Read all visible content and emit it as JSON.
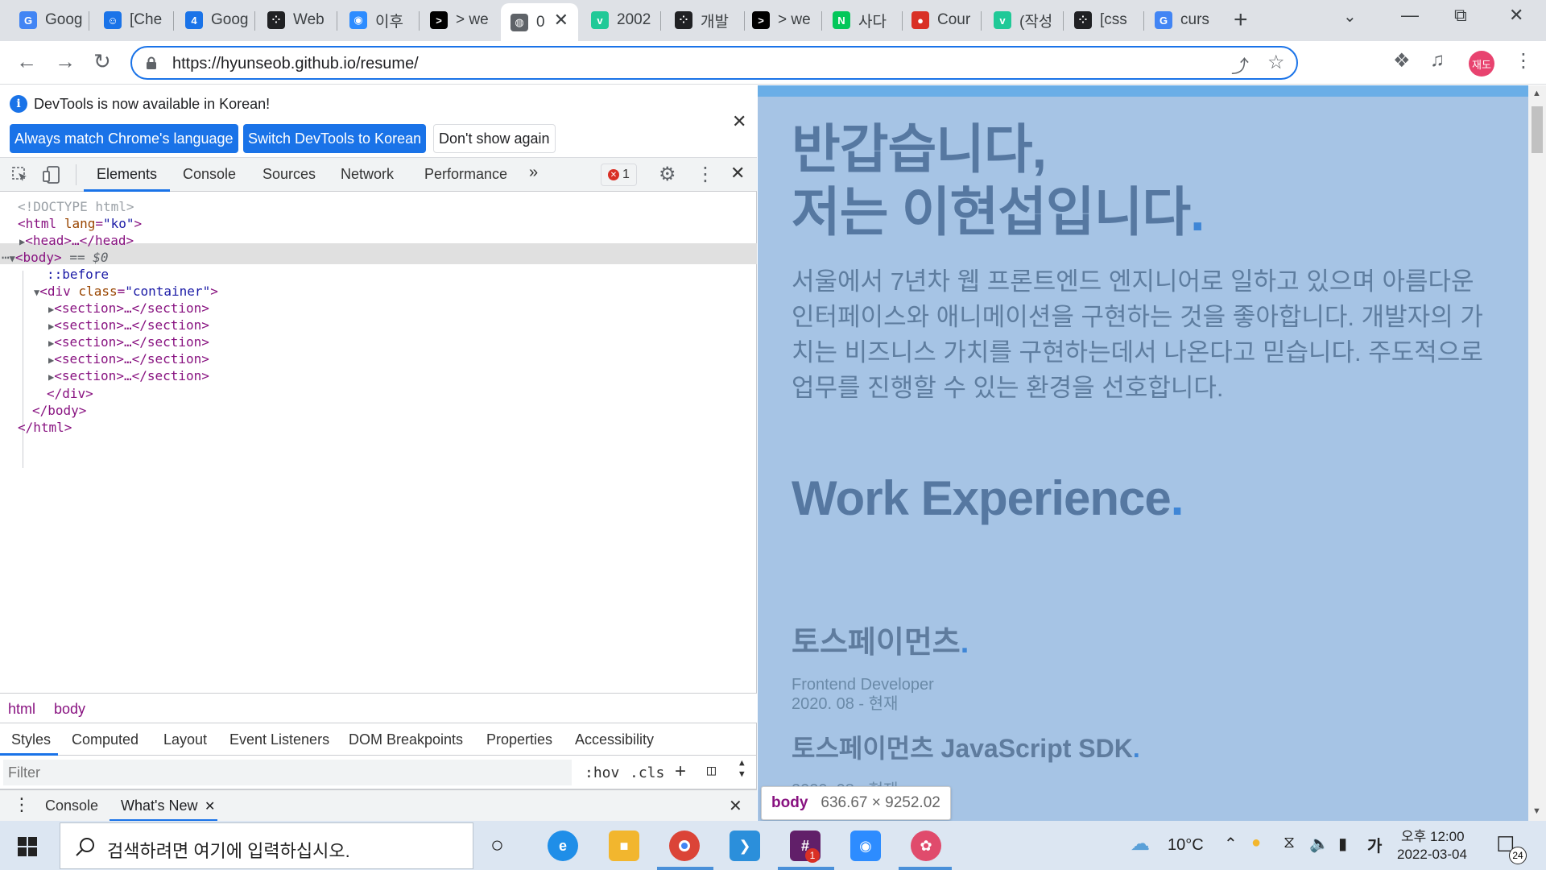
{
  "browser": {
    "tabs": [
      {
        "title": "Goog",
        "favicon": "google-icon",
        "color": "#4285f4",
        "glyph": "G"
      },
      {
        "title": "[Che",
        "favicon": "contacts-icon",
        "color": "#1a73e8",
        "glyph": "☺"
      },
      {
        "title": "Goog",
        "favicon": "google-calendar-icon",
        "color": "#1a73e8",
        "glyph": "4"
      },
      {
        "title": "Web",
        "favicon": "dots-icon",
        "color": "#202124",
        "glyph": "⁘"
      },
      {
        "title": "이후",
        "favicon": "zoom-icon",
        "color": "#2d8cff",
        "glyph": "◉"
      },
      {
        "title": "> we",
        "favicon": "terminal-icon",
        "color": "#000000",
        "glyph": ">"
      },
      {
        "title": "0",
        "favicon": "globe-icon",
        "color": "#5f6368",
        "glyph": "◍",
        "active": true
      },
      {
        "title": "2002",
        "favicon": "v-icon",
        "color": "#20c997",
        "glyph": "v"
      },
      {
        "title": "개발",
        "favicon": "dots-icon",
        "color": "#202124",
        "glyph": "⁘"
      },
      {
        "title": "> we",
        "favicon": "terminal-icon",
        "color": "#000000",
        "glyph": ">"
      },
      {
        "title": "사다",
        "favicon": "naver-icon",
        "color": "#03c75a",
        "glyph": "N"
      },
      {
        "title": "Cour",
        "favicon": "apple-icon",
        "color": "#d93025",
        "glyph": "●"
      },
      {
        "title": "(작성",
        "favicon": "v-icon",
        "color": "#20c997",
        "glyph": "v"
      },
      {
        "title": "[css",
        "favicon": "dots-icon",
        "color": "#202124",
        "glyph": "⁘"
      },
      {
        "title": "curs",
        "favicon": "google-icon",
        "color": "#4285f4",
        "glyph": "G"
      }
    ],
    "url": "https://hyunseob.github.io/resume/",
    "profile_initials": "재도",
    "extensions": [
      {
        "label": "EX",
        "color": "#e8710a"
      },
      {
        "label": "●",
        "color": "#12b5cb"
      }
    ]
  },
  "devtools": {
    "info": {
      "text": "DevTools is now available in Korean!",
      "btn_match": "Always match Chrome's language",
      "btn_switch": "Switch DevTools to Korean",
      "btn_dismiss": "Don't show again"
    },
    "tabs": [
      "Elements",
      "Console",
      "Sources",
      "Network",
      "Performance"
    ],
    "error_count": "1",
    "dom": {
      "doctype": "<!DOCTYPE html>",
      "html_open_tag": "html",
      "html_attr": "lang",
      "html_val": "\"ko\"",
      "head": "head",
      "body": "body",
      "body_eq": "== $0",
      "before": "::before",
      "div_attr": "class",
      "div_val": "\"container\"",
      "section": "section",
      "div_close": "</div>",
      "body_close": "</body>",
      "html_close": "</html>"
    },
    "breadcrumbs": [
      "html",
      "body"
    ],
    "style_tabs": [
      "Styles",
      "Computed",
      "Layout",
      "Event Listeners",
      "DOM Breakpoints",
      "Properties",
      "Accessibility"
    ],
    "filter_placeholder": "Filter",
    "hov": ":hov",
    "cls": ".cls",
    "drawer_tabs": [
      "Console",
      "What's New"
    ]
  },
  "page": {
    "hero_line1": "반갑습니다,",
    "hero_line2": "저는 이현섭입니다",
    "dot": ".",
    "intro": "서울에서 7년차 웹 프론트엔드 엔지니어로 일하고 있으며 아름다운 인터페이스와 애니메이션을 구현하는 것을 좋아합니다. 개발자의 가치는 비즈니스 가치를 구현하는데서 나온다고 믿습니다. 주도적으로 업무를 진행할 수 있는 환경을 선호합니다.",
    "work_title": "Work Experience",
    "company": "토스페이먼츠",
    "role": "Frontend Developer",
    "period": "2020. 08 - 현재",
    "project": "토스페이먼츠 JavaScript SDK",
    "project_period": "2020. 08 - 현재",
    "tooltip_tag": "body",
    "tooltip_size": "636.67 × 9252.02"
  },
  "taskbar": {
    "search_placeholder": "검색하려면 여기에 입력하십시오.",
    "weather": "10°C",
    "ime": "가",
    "time": "오후 12:00",
    "date": "2022-03-04",
    "notification_count": "24",
    "slack_badge": "1"
  }
}
